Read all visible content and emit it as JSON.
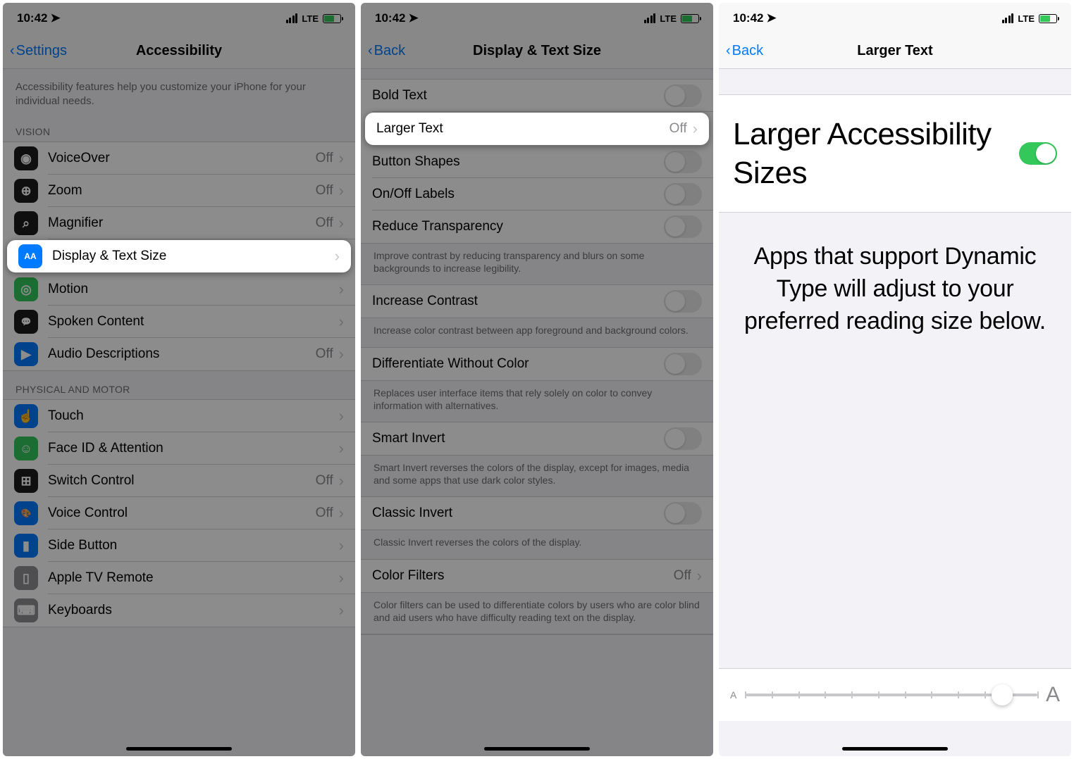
{
  "status": {
    "time": "10:42",
    "network": "LTE"
  },
  "screen1": {
    "back": "Settings",
    "title": "Accessibility",
    "intro": "Accessibility features help you customize your iPhone for your individual needs.",
    "visionHeader": "VISION",
    "vision": [
      {
        "label": "VoiceOver",
        "value": "Off",
        "color": "#1c1c1e",
        "glyph": "◉"
      },
      {
        "label": "Zoom",
        "value": "Off",
        "color": "#1c1c1e",
        "glyph": "⊕"
      },
      {
        "label": "Magnifier",
        "value": "Off",
        "color": "#1c1c1e",
        "glyph": "⌕"
      },
      {
        "label": "Display & Text Size",
        "value": "",
        "color": "#007aff",
        "glyph": "AA"
      },
      {
        "label": "Motion",
        "value": "",
        "color": "#34c759",
        "glyph": "◎"
      },
      {
        "label": "Spoken Content",
        "value": "",
        "color": "#1c1c1e",
        "glyph": "💬"
      },
      {
        "label": "Audio Descriptions",
        "value": "Off",
        "color": "#007aff",
        "glyph": "▶"
      }
    ],
    "motorHeader": "PHYSICAL AND MOTOR",
    "motor": [
      {
        "label": "Touch",
        "value": "",
        "color": "#007aff",
        "glyph": "☝"
      },
      {
        "label": "Face ID & Attention",
        "value": "",
        "color": "#34c759",
        "glyph": "☺"
      },
      {
        "label": "Switch Control",
        "value": "Off",
        "color": "#1c1c1e",
        "glyph": "⊞"
      },
      {
        "label": "Voice Control",
        "value": "Off",
        "color": "#007aff",
        "glyph": "🎨"
      },
      {
        "label": "Side Button",
        "value": "",
        "color": "#007aff",
        "glyph": "▮"
      },
      {
        "label": "Apple TV Remote",
        "value": "",
        "color": "#8e8e93",
        "glyph": "▯"
      },
      {
        "label": "Keyboards",
        "value": "",
        "color": "#8e8e93",
        "glyph": "⌨"
      }
    ]
  },
  "screen2": {
    "back": "Back",
    "title": "Display & Text Size",
    "rows": [
      {
        "label": "Bold Text",
        "toggle": false
      },
      {
        "label": "Larger Text",
        "value": "Off",
        "highlight": true
      },
      {
        "label": "Button Shapes",
        "toggle": false
      },
      {
        "label": "On/Off Labels",
        "toggle": false
      },
      {
        "label": "Reduce Transparency",
        "toggle": false,
        "footer": "Improve contrast by reducing transparency and blurs on some backgrounds to increase legibility."
      },
      {
        "label": "Increase Contrast",
        "toggle": false,
        "footer": "Increase color contrast between app foreground and background colors."
      },
      {
        "label": "Differentiate Without Color",
        "toggle": false,
        "footer": "Replaces user interface items that rely solely on color to convey information with alternatives."
      },
      {
        "label": "Smart Invert",
        "toggle": false,
        "footer": "Smart Invert reverses the colors of the display, except for images, media and some apps that use dark color styles."
      },
      {
        "label": "Classic Invert",
        "toggle": false,
        "footer": "Classic Invert reverses the colors of the display."
      },
      {
        "label": "Color Filters",
        "value": "Off",
        "footer": "Color filters can be used to differentiate colors by users who are color blind and aid users who have difficulty reading text on the display."
      }
    ]
  },
  "screen3": {
    "back": "Back",
    "title": "Larger Text",
    "toggleLabel": "Larger Accessibility Sizes",
    "toggleOn": true,
    "desc": "Apps that support Dynamic Type will adjust to your preferred reading size below.",
    "sliderSmall": "A",
    "sliderLarge": "A",
    "sliderTicks": 12,
    "sliderPos": 0.88
  }
}
